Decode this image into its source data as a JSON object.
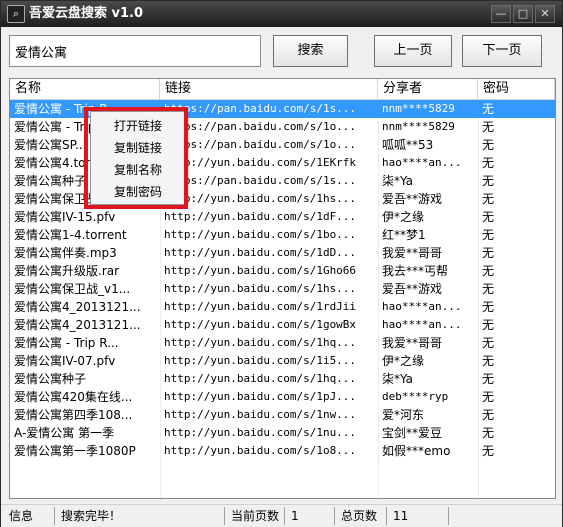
{
  "window": {
    "title": "吾爱云盘搜索 v1.0",
    "icon": "search-icon",
    "minimize_glyph": "—",
    "maximize_glyph": "□",
    "close_glyph": "✕"
  },
  "toolbar": {
    "search_value": "爱情公寓",
    "search_label": "搜索",
    "prev_label": "上一页",
    "next_label": "下一页"
  },
  "table": {
    "columns": [
      "名称",
      "链接",
      "分享者",
      "密码"
    ],
    "rows": [
      {
        "name": "爱情公寓 - Trip R...",
        "link": "https://pan.baidu.com/s/1s...",
        "sharer": "nnm****5829",
        "password": "无"
      },
      {
        "name": "爱情公寓 - Trip R...",
        "link": "https://pan.baidu.com/s/1o...",
        "sharer": "nnm****5829",
        "password": "无"
      },
      {
        "name": "爱情公寓SP...",
        "link": "https://pan.baidu.com/s/1o...",
        "sharer": "呱呱**53",
        "password": "无"
      },
      {
        "name": "爱情公寓4.torrent",
        "link": "http://yun.baidu.com/s/1EKrfk",
        "sharer": "hao****an...",
        "password": "无"
      },
      {
        "name": "爱情公寓种子",
        "link": "https://pan.baidu.com/s/1s...",
        "sharer": "柒*Ya",
        "password": "无"
      },
      {
        "name": "爱情公寓保卫战",
        "link": "http://yun.baidu.com/s/1hs...",
        "sharer": "爱吾**游戏",
        "password": "无"
      },
      {
        "name": "爱情公寓IV-15.pfv",
        "link": "http://yun.baidu.com/s/1dF...",
        "sharer": "伊*之缘",
        "password": "无"
      },
      {
        "name": "爱情公寓1-4.torrent",
        "link": "http://yun.baidu.com/s/1bo...",
        "sharer": "红**梦1",
        "password": "无"
      },
      {
        "name": "爱情公寓伴奏.mp3",
        "link": "http://yun.baidu.com/s/1dD...",
        "sharer": "我爱**哥哥",
        "password": "无"
      },
      {
        "name": "爱情公寓升级版.rar",
        "link": "http://yun.baidu.com/s/1Gho66",
        "sharer": "我去***丐帮",
        "password": "无"
      },
      {
        "name": "爱情公寓保卫战_v1...",
        "link": "http://yun.baidu.com/s/1hs...",
        "sharer": "爱吾**游戏",
        "password": "无"
      },
      {
        "name": "爱情公寓4_2013121...",
        "link": "http://yun.baidu.com/s/1rdJii",
        "sharer": "hao****an...",
        "password": "无"
      },
      {
        "name": "爱情公寓4_2013121...",
        "link": "http://yun.baidu.com/s/1gowBx",
        "sharer": "hao****an...",
        "password": "无"
      },
      {
        "name": "爱情公寓 - Trip R...",
        "link": "http://yun.baidu.com/s/1hq...",
        "sharer": "我爱**哥哥",
        "password": "无"
      },
      {
        "name": "爱情公寓IV-07.pfv",
        "link": "http://yun.baidu.com/s/1i5...",
        "sharer": "伊*之缘",
        "password": "无"
      },
      {
        "name": "爱情公寓种子",
        "link": "http://yun.baidu.com/s/1hq...",
        "sharer": "柒*Ya",
        "password": "无"
      },
      {
        "name": "爱情公寓420集在线...",
        "link": "http://yun.baidu.com/s/1pJ...",
        "sharer": "deb****ryp",
        "password": "无"
      },
      {
        "name": "爱情公寓第四季108...",
        "link": "http://yun.baidu.com/s/1nw...",
        "sharer": "爱*河东",
        "password": "无"
      },
      {
        "name": "A-爱情公寓 第一季",
        "link": "http://yun.baidu.com/s/1nu...",
        "sharer": "宝剑**爱豆",
        "password": "无"
      },
      {
        "name": "爱情公寓第一季1080P",
        "link": "http://yun.baidu.com/s/1o8...",
        "sharer": "如假***emo",
        "password": "无"
      }
    ]
  },
  "context_menu": {
    "items": [
      "打开链接",
      "复制链接",
      "复制名称",
      "复制密码"
    ]
  },
  "statusbar": {
    "info_label": "信息",
    "info_value": "搜索完毕！",
    "current_page_label": "当前页数",
    "current_page_value": "1",
    "total_pages_label": "总页数",
    "total_pages_value": "11"
  },
  "colors": {
    "selection": "#3399ff",
    "highlight_border": "#e0161c",
    "titlebar": "#2b2b2b"
  }
}
